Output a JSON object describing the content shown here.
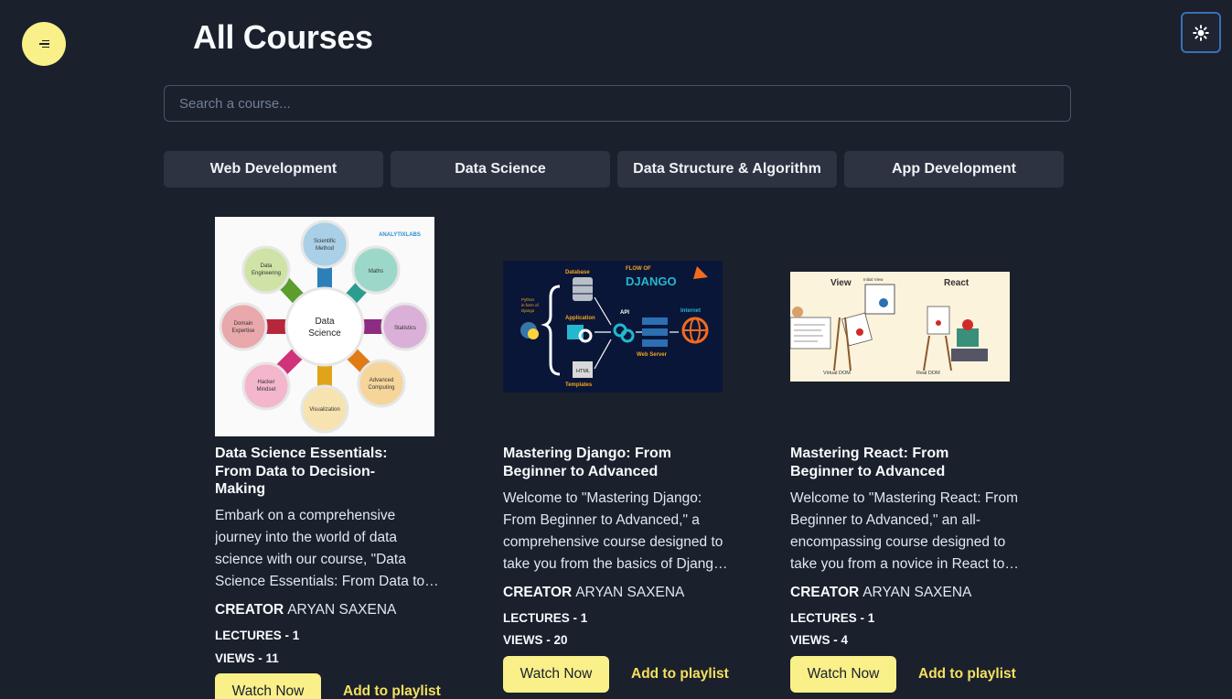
{
  "header": {
    "title": "All Courses",
    "search_placeholder": "Search a course..."
  },
  "categories": [
    "Web Development",
    "Data Science",
    "Data Structure & Algorithm",
    "App Development"
  ],
  "courses": [
    {
      "title": "Data Science Essentials: From Data to Decision-Making",
      "description": "Embark on a comprehensive journey into the world of data science with our course, \"Data Science Essentials: From Data to Decision-Making\"",
      "creator_label": "CREATOR",
      "creator": "ARYAN SAXENA",
      "lectures": "LECTURES - 1",
      "views": "VIEWS - 11",
      "watch_label": "Watch Now",
      "playlist_label": "Add to playlist",
      "thumb": {
        "brand": "ANALYTIXLABS",
        "center": [
          "Data",
          "Science"
        ],
        "nodes": [
          [
            "Scientific",
            "Method"
          ],
          [
            "Maths"
          ],
          [
            "Statistics"
          ],
          [
            "Advanced",
            "Computing"
          ],
          [
            "Visualization"
          ],
          [
            "Hacker",
            "Mindset"
          ],
          [
            "Domain",
            "Expertise"
          ],
          [
            "Data",
            "Engineering"
          ]
        ]
      }
    },
    {
      "title": "Mastering Django: From Beginner to Advanced",
      "description": "Welcome to \"Mastering Django: From Beginner to Advanced,\" a comprehensive course designed to take you from the basics of Django to advanced concepts.",
      "creator_label": "CREATOR",
      "creator": "ARYAN SAXENA",
      "lectures": "LECTURES - 1",
      "views": "VIEWS - 20",
      "watch_label": "Watch Now",
      "playlist_label": "Add to playlist",
      "thumb": {
        "flow_of": "FLOW OF",
        "django": "DJANGO",
        "database": "Database",
        "application": "Application",
        "python_note": [
          "Python",
          "in form of",
          "Django"
        ],
        "api": "API",
        "internet": "Internet",
        "web_server": "Web Server",
        "html": "HTML",
        "templates": "Templates"
      }
    },
    {
      "title": "Mastering React: From Beginner to Advanced",
      "description": "Welcome to \"Mastering React: From Beginner to Advanced,\" an all-encompassing course designed to take you from a novice in React to an expert.",
      "creator_label": "CREATOR",
      "creator": "ARYAN SAXENA",
      "lectures": "LECTURES - 1",
      "views": "VIEWS - 4",
      "watch_label": "Watch Now",
      "playlist_label": "Add to playlist",
      "thumb": {
        "view": "View",
        "react": "React",
        "initial_view": "Initial View",
        "virtual_dom": "Virtual DOM",
        "real_dom": "Real DOM"
      }
    }
  ],
  "colors": {
    "background": "#1a202c",
    "accent": "#faf089",
    "accent_text": "#f6e05e",
    "category_bg": "#2d3340"
  },
  "icons": {
    "menu": "menu-lines-icon",
    "theme": "sun-icon"
  }
}
